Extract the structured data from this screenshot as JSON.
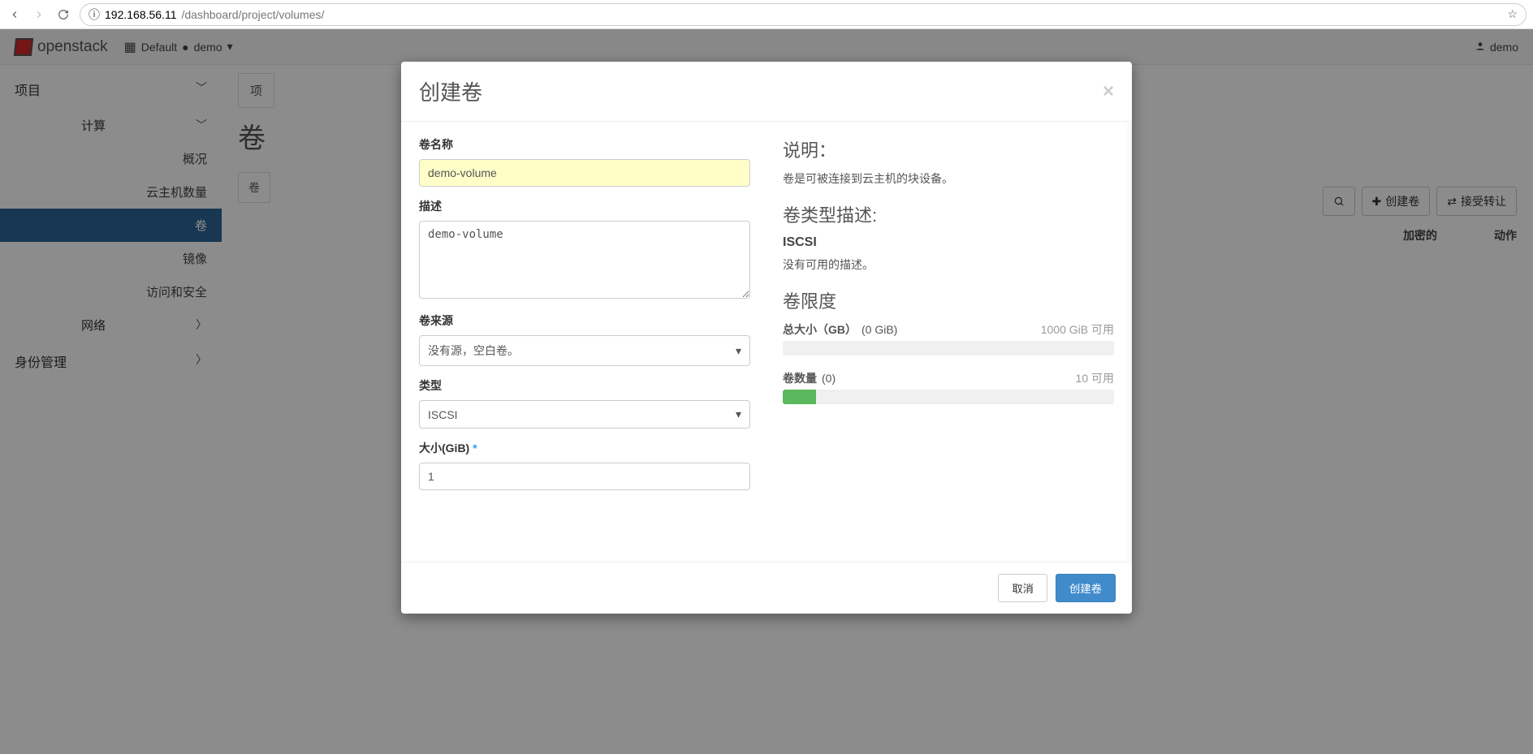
{
  "browser": {
    "host": "192.168.56.11",
    "path": "/dashboard/project/volumes/"
  },
  "appbar": {
    "brand": "openstack",
    "context_domain": "Default",
    "context_project": "demo",
    "user": "demo"
  },
  "sidebar": {
    "lvl1_project": "项目",
    "lvl2_compute": "计算",
    "items_compute": [
      "概况",
      "云主机数量",
      "卷",
      "镜像",
      "访问和安全"
    ],
    "lvl2_network": "网络",
    "lvl1_identity": "身份管理"
  },
  "main": {
    "breadcrumb": "项",
    "title": "卷",
    "tab": "卷",
    "toolbar": {
      "create": "创建卷",
      "accept": "接受转让"
    },
    "columns": {
      "encrypted": "加密的",
      "actions": "动作"
    }
  },
  "modal": {
    "title": "创建卷",
    "labels": {
      "name": "卷名称",
      "desc": "描述",
      "source": "卷来源",
      "type": "类型",
      "size": "大小(GiB)"
    },
    "values": {
      "name": "demo-volume",
      "desc": "demo-volume",
      "source": "没有源，空白卷。",
      "type": "ISCSI",
      "size": "1"
    },
    "help": {
      "title": "说明：",
      "text": "卷是可被连接到云主机的块设备。",
      "type_title": "卷类型描述:",
      "type_name": "ISCSI",
      "type_text": "没有可用的描述。",
      "limits_title": "卷限度",
      "quota_size_label": "总大小（GB）",
      "quota_size_used": "(0 GiB)",
      "quota_size_avail": "1000 GiB 可用",
      "quota_count_label": "卷数量",
      "quota_count_used": "(0)",
      "quota_count_avail": "10 可用"
    },
    "footer": {
      "cancel": "取消",
      "submit": "创建卷"
    }
  }
}
